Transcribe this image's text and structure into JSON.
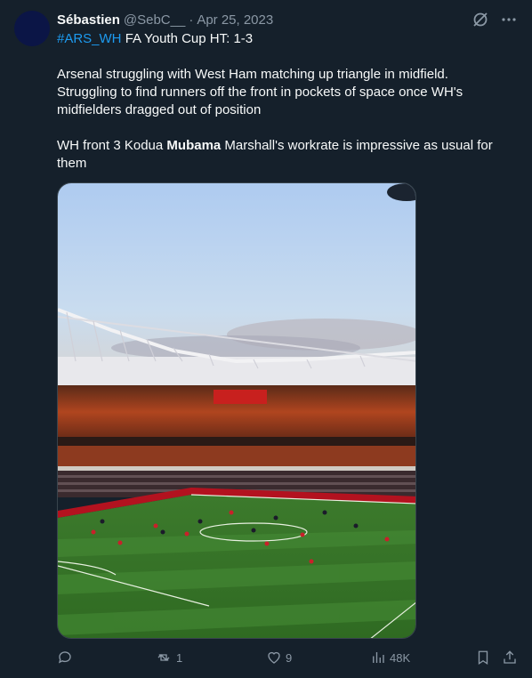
{
  "author": {
    "display_name": "Sébastien",
    "handle": "@SebC__",
    "separator": "·",
    "date": "Apr 25, 2023"
  },
  "tweet": {
    "hashtag": "#ARS_WH",
    "line1_rest": " FA Youth Cup HT: 1-3",
    "para2_line1": "Arsenal struggling with West Ham matching up triangle in midfield.",
    "para2_line2": "Struggling to find runners off the front in pockets of space once WH's",
    "para2_line3": "midfielders dragged out of position",
    "para3_pre": "WH front 3 Kodua ",
    "para3_bold": "Mubama",
    "para3_post": " Marshall's workrate is impressive as usual for",
    "para3_line2": "them"
  },
  "actions": {
    "reply_count": "",
    "retweet_count": "1",
    "like_count": "9",
    "views_count": "48K"
  },
  "icons": {
    "top": [
      "grok-icon",
      "more-icon"
    ],
    "bottom": [
      "reply-icon",
      "retweet-icon",
      "like-icon",
      "views-icon",
      "bookmark-icon",
      "share-icon"
    ]
  },
  "colors": {
    "background": "#15202b",
    "text": "#f7f9f9",
    "muted": "#8b98a5",
    "link": "#1d9bf0"
  }
}
